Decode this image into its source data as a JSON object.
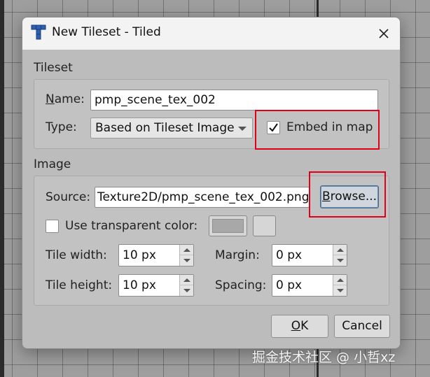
{
  "window": {
    "title": "New Tileset - Tiled",
    "icons": {
      "app": "tiled-app-icon",
      "close": "close-icon"
    }
  },
  "tileset_group": {
    "label": "Tileset",
    "name_label": "Name:",
    "name_value": "pmp_scene_tex_002",
    "type_label": "Type:",
    "type_value": "Based on Tileset Image",
    "embed_label": "Embed in map",
    "embed_checked": true
  },
  "image_group": {
    "label": "Image",
    "source_label": "Source:",
    "source_value": "Texture2D/pmp_scene_tex_002.png",
    "browse_label": "Browse...",
    "transparent_label": "Use transparent color:",
    "transparent_checked": false,
    "tile_width_label": "Tile width:",
    "tile_width_value": "10 px",
    "tile_height_label": "Tile height:",
    "tile_height_value": "10 px",
    "margin_label": "Margin:",
    "margin_value": "0 px",
    "spacing_label": "Spacing:",
    "spacing_value": "0 px"
  },
  "buttons": {
    "ok_label": "OK",
    "cancel_label": "Cancel"
  },
  "watermark": "掘金技术社区 @ 小哲xz",
  "colors": {
    "annotation_red": "#e0001a",
    "dialog_bg": "#bcbcbc",
    "titlebar_bg": "#f3f3f3"
  }
}
